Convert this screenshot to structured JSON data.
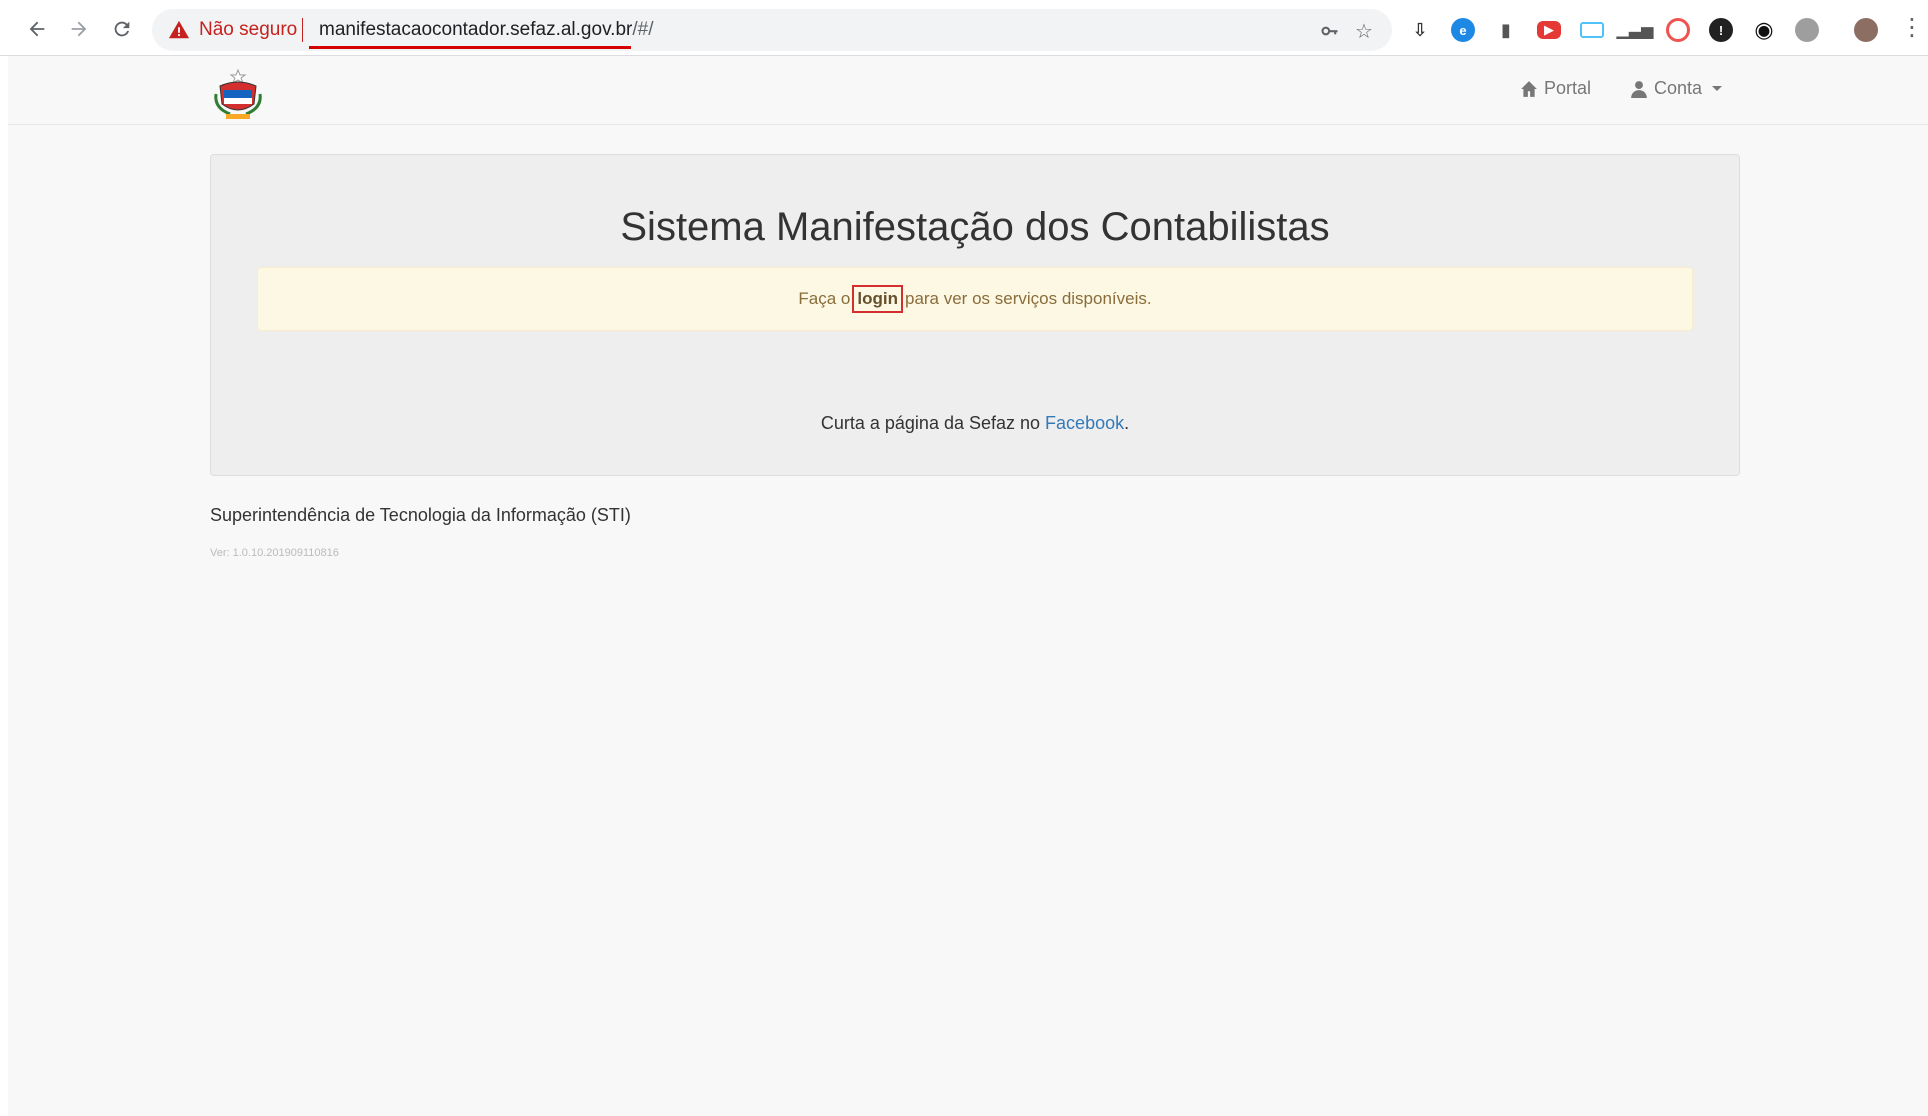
{
  "browser": {
    "back_icon": "arrow-left-icon",
    "forward_icon": "arrow-right-icon",
    "reload_icon": "reload-icon",
    "security_warning": "Não seguro",
    "url_host": "manifestacaocontador.sefaz.al.gov.br",
    "url_path": "/#/",
    "extensions": [
      "key-icon",
      "star-icon",
      "download-ext-icon",
      "circle-e-icon",
      "usb-icon",
      "video-icon",
      "window-icon",
      "signal-icon",
      "target-icon",
      "shield-icon",
      "eye-icon",
      "cookie-icon",
      "avatar-icon"
    ],
    "colors": {
      "warning_red": "#c5221f",
      "underline_red": "#d50000"
    }
  },
  "navbar": {
    "logo_icon": "state-coat-of-arms-icon",
    "portal_label": "Portal",
    "account_label": "Conta"
  },
  "main": {
    "title": "Sistema Manifestação dos Contabilistas",
    "alert": {
      "before": "Faça o",
      "login_link": "login",
      "after": "para ver os serviços disponíveis."
    },
    "facebook": {
      "before": "Curta a página da Sefaz no",
      "link": "Facebook",
      "after": "."
    }
  },
  "footer": {
    "organization": "Superintendência de Tecnologia da Informação (STI)",
    "version": "Ver: 1.0.10.201909110816"
  }
}
